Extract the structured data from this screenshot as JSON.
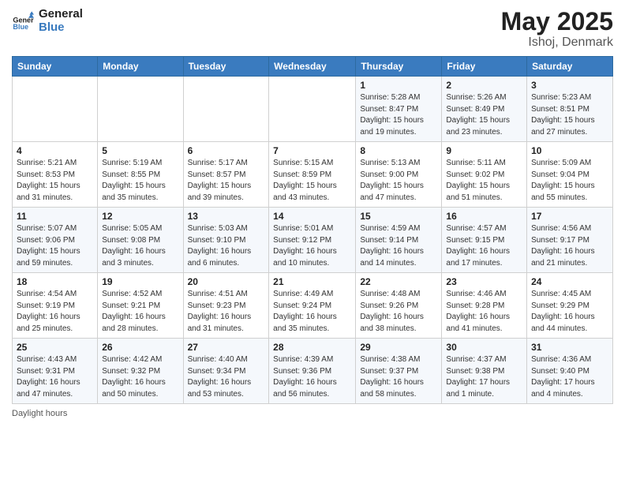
{
  "logo": {
    "text_general": "General",
    "text_blue": "Blue"
  },
  "header": {
    "month": "May 2025",
    "location": "Ishoj, Denmark"
  },
  "weekdays": [
    "Sunday",
    "Monday",
    "Tuesday",
    "Wednesday",
    "Thursday",
    "Friday",
    "Saturday"
  ],
  "footer": {
    "daylight_label": "Daylight hours"
  },
  "weeks": [
    {
      "days": [
        {
          "num": "",
          "info": ""
        },
        {
          "num": "",
          "info": ""
        },
        {
          "num": "",
          "info": ""
        },
        {
          "num": "",
          "info": ""
        },
        {
          "num": "1",
          "info": "Sunrise: 5:28 AM\nSunset: 8:47 PM\nDaylight: 15 hours\nand 19 minutes."
        },
        {
          "num": "2",
          "info": "Sunrise: 5:26 AM\nSunset: 8:49 PM\nDaylight: 15 hours\nand 23 minutes."
        },
        {
          "num": "3",
          "info": "Sunrise: 5:23 AM\nSunset: 8:51 PM\nDaylight: 15 hours\nand 27 minutes."
        }
      ]
    },
    {
      "days": [
        {
          "num": "4",
          "info": "Sunrise: 5:21 AM\nSunset: 8:53 PM\nDaylight: 15 hours\nand 31 minutes."
        },
        {
          "num": "5",
          "info": "Sunrise: 5:19 AM\nSunset: 8:55 PM\nDaylight: 15 hours\nand 35 minutes."
        },
        {
          "num": "6",
          "info": "Sunrise: 5:17 AM\nSunset: 8:57 PM\nDaylight: 15 hours\nand 39 minutes."
        },
        {
          "num": "7",
          "info": "Sunrise: 5:15 AM\nSunset: 8:59 PM\nDaylight: 15 hours\nand 43 minutes."
        },
        {
          "num": "8",
          "info": "Sunrise: 5:13 AM\nSunset: 9:00 PM\nDaylight: 15 hours\nand 47 minutes."
        },
        {
          "num": "9",
          "info": "Sunrise: 5:11 AM\nSunset: 9:02 PM\nDaylight: 15 hours\nand 51 minutes."
        },
        {
          "num": "10",
          "info": "Sunrise: 5:09 AM\nSunset: 9:04 PM\nDaylight: 15 hours\nand 55 minutes."
        }
      ]
    },
    {
      "days": [
        {
          "num": "11",
          "info": "Sunrise: 5:07 AM\nSunset: 9:06 PM\nDaylight: 15 hours\nand 59 minutes."
        },
        {
          "num": "12",
          "info": "Sunrise: 5:05 AM\nSunset: 9:08 PM\nDaylight: 16 hours\nand 3 minutes."
        },
        {
          "num": "13",
          "info": "Sunrise: 5:03 AM\nSunset: 9:10 PM\nDaylight: 16 hours\nand 6 minutes."
        },
        {
          "num": "14",
          "info": "Sunrise: 5:01 AM\nSunset: 9:12 PM\nDaylight: 16 hours\nand 10 minutes."
        },
        {
          "num": "15",
          "info": "Sunrise: 4:59 AM\nSunset: 9:14 PM\nDaylight: 16 hours\nand 14 minutes."
        },
        {
          "num": "16",
          "info": "Sunrise: 4:57 AM\nSunset: 9:15 PM\nDaylight: 16 hours\nand 17 minutes."
        },
        {
          "num": "17",
          "info": "Sunrise: 4:56 AM\nSunset: 9:17 PM\nDaylight: 16 hours\nand 21 minutes."
        }
      ]
    },
    {
      "days": [
        {
          "num": "18",
          "info": "Sunrise: 4:54 AM\nSunset: 9:19 PM\nDaylight: 16 hours\nand 25 minutes."
        },
        {
          "num": "19",
          "info": "Sunrise: 4:52 AM\nSunset: 9:21 PM\nDaylight: 16 hours\nand 28 minutes."
        },
        {
          "num": "20",
          "info": "Sunrise: 4:51 AM\nSunset: 9:23 PM\nDaylight: 16 hours\nand 31 minutes."
        },
        {
          "num": "21",
          "info": "Sunrise: 4:49 AM\nSunset: 9:24 PM\nDaylight: 16 hours\nand 35 minutes."
        },
        {
          "num": "22",
          "info": "Sunrise: 4:48 AM\nSunset: 9:26 PM\nDaylight: 16 hours\nand 38 minutes."
        },
        {
          "num": "23",
          "info": "Sunrise: 4:46 AM\nSunset: 9:28 PM\nDaylight: 16 hours\nand 41 minutes."
        },
        {
          "num": "24",
          "info": "Sunrise: 4:45 AM\nSunset: 9:29 PM\nDaylight: 16 hours\nand 44 minutes."
        }
      ]
    },
    {
      "days": [
        {
          "num": "25",
          "info": "Sunrise: 4:43 AM\nSunset: 9:31 PM\nDaylight: 16 hours\nand 47 minutes."
        },
        {
          "num": "26",
          "info": "Sunrise: 4:42 AM\nSunset: 9:32 PM\nDaylight: 16 hours\nand 50 minutes."
        },
        {
          "num": "27",
          "info": "Sunrise: 4:40 AM\nSunset: 9:34 PM\nDaylight: 16 hours\nand 53 minutes."
        },
        {
          "num": "28",
          "info": "Sunrise: 4:39 AM\nSunset: 9:36 PM\nDaylight: 16 hours\nand 56 minutes."
        },
        {
          "num": "29",
          "info": "Sunrise: 4:38 AM\nSunset: 9:37 PM\nDaylight: 16 hours\nand 58 minutes."
        },
        {
          "num": "30",
          "info": "Sunrise: 4:37 AM\nSunset: 9:38 PM\nDaylight: 17 hours\nand 1 minute."
        },
        {
          "num": "31",
          "info": "Sunrise: 4:36 AM\nSunset: 9:40 PM\nDaylight: 17 hours\nand 4 minutes."
        }
      ]
    }
  ]
}
